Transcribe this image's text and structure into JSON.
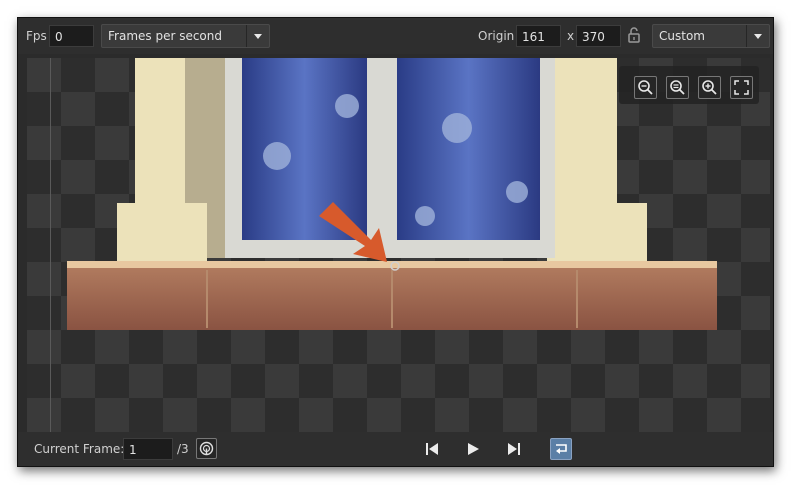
{
  "toolbar": {
    "fps_label": "Fps",
    "fps_value": "0",
    "fps_mode": "Frames per second",
    "origin_label": "Origin",
    "origin_x": "161",
    "origin_sep": "x",
    "origin_y": "370",
    "origin_preset": "Custom"
  },
  "zoom": {
    "icons": [
      "zoom-out-icon",
      "zoom-reset-icon",
      "zoom-in-icon",
      "fullscreen-icon"
    ]
  },
  "footer": {
    "current_frame_label": "Current Frame:",
    "current_frame_value": "1",
    "total_frames": "/3"
  },
  "colors": {
    "background": "#2b2b2b",
    "arrow": "#d75a2c",
    "loop_active": "#5b7fa6"
  }
}
